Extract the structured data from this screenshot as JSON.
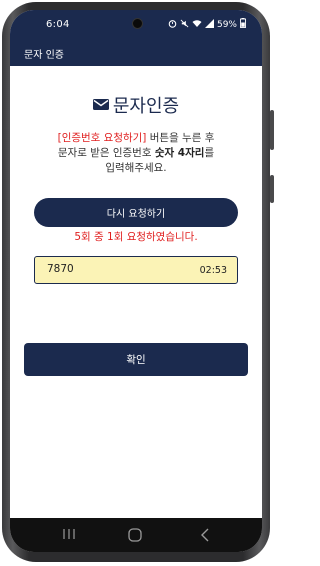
{
  "status_bar": {
    "time": "6:04",
    "battery": "59%",
    "icons": [
      "alarm-icon",
      "mute-icon",
      "wifi-icon",
      "signal-icon",
      "battery-icon"
    ]
  },
  "app_bar": {
    "title": "문자 인증"
  },
  "heading": {
    "icon": "envelope-icon",
    "title": "문자인증"
  },
  "description": {
    "line1_highlight": "[인증번호 요청하기]",
    "line1_rest": " 버튼을 누른 후",
    "line2_prefix": "문자로 받은 인증번호 ",
    "line2_bold": "숫자 4자리",
    "line2_suffix": "를",
    "line3": "입력해주세요."
  },
  "resend_button": {
    "label": "다시 요청하기"
  },
  "attempt_message": "5회 중 1회 요청하였습니다.",
  "code_field": {
    "value": "7870",
    "timer": "02:53"
  },
  "confirm_button": {
    "label": "확인"
  },
  "nav_bar": {
    "recents": "recents-icon",
    "home": "home-icon",
    "back": "back-icon"
  },
  "colors": {
    "primary": "#1b2a4e",
    "accent_red": "#e02020",
    "input_bg": "#fbf3b6"
  }
}
